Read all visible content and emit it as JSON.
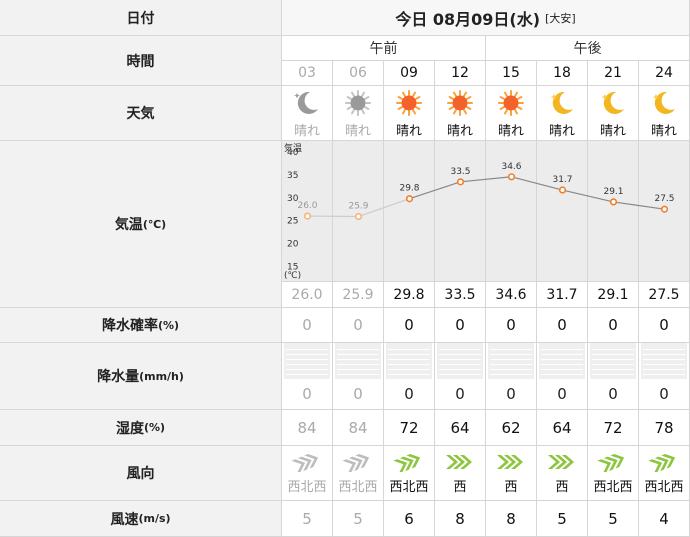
{
  "header": {
    "date_label": "日付",
    "title": "今日 08月09日(水)",
    "rokuyo": "[大安]"
  },
  "ampm": [
    "午前",
    "午後"
  ],
  "labels": {
    "time": "時間",
    "weather": "天気",
    "temp": "気温",
    "temp_unit": "(℃)",
    "precip_prob": "降水確率",
    "precip_prob_unit": "(%)",
    "precip_amount": "降水量",
    "precip_amount_unit": "(mm/h)",
    "humidity": "湿度",
    "humidity_unit": "(%)",
    "wind_dir": "風向",
    "wind_speed": "風速",
    "wind_speed_unit": "(m/s)"
  },
  "chart_axis": {
    "top_label": "気温",
    "bottom_label": "(℃)",
    "ticks": [
      "40",
      "35",
      "30",
      "25",
      "20",
      "15"
    ]
  },
  "hours": [
    {
      "time": "03",
      "icon": "moon-cloud-icon",
      "weather": "晴れ",
      "temp": 26.0,
      "temp_text": "26.0",
      "prob": "0",
      "amount": "0",
      "humidity": "84",
      "wind_dir": "西北西",
      "wind_speed": "5",
      "past": true
    },
    {
      "time": "06",
      "icon": "sun-cloud-icon",
      "weather": "晴れ",
      "temp": 25.9,
      "temp_text": "25.9",
      "prob": "0",
      "amount": "0",
      "humidity": "84",
      "wind_dir": "西北西",
      "wind_speed": "5",
      "past": true
    },
    {
      "time": "09",
      "icon": "sun-icon",
      "weather": "晴れ",
      "temp": 29.8,
      "temp_text": "29.8",
      "prob": "0",
      "amount": "0",
      "humidity": "72",
      "wind_dir": "西北西",
      "wind_speed": "6",
      "past": false
    },
    {
      "time": "12",
      "icon": "sun-icon",
      "weather": "晴れ",
      "temp": 33.5,
      "temp_text": "33.5",
      "prob": "0",
      "amount": "0",
      "humidity": "64",
      "wind_dir": "西",
      "wind_speed": "8",
      "past": false
    },
    {
      "time": "15",
      "icon": "sun-icon",
      "weather": "晴れ",
      "temp": 34.6,
      "temp_text": "34.6",
      "prob": "0",
      "amount": "0",
      "humidity": "62",
      "wind_dir": "西",
      "wind_speed": "8",
      "past": false
    },
    {
      "time": "18",
      "icon": "moon-icon",
      "weather": "晴れ",
      "temp": 31.7,
      "temp_text": "31.7",
      "prob": "0",
      "amount": "0",
      "humidity": "64",
      "wind_dir": "西",
      "wind_speed": "5",
      "past": false
    },
    {
      "time": "21",
      "icon": "moon-icon",
      "weather": "晴れ",
      "temp": 29.1,
      "temp_text": "29.1",
      "prob": "0",
      "amount": "0",
      "humidity": "72",
      "wind_dir": "西北西",
      "wind_speed": "5",
      "past": false
    },
    {
      "time": "24",
      "icon": "moon-icon",
      "weather": "晴れ",
      "temp": 27.5,
      "temp_text": "27.5",
      "prob": "0",
      "amount": "0",
      "humidity": "78",
      "wind_dir": "西北西",
      "wind_speed": "4",
      "past": false
    }
  ],
  "colors": {
    "sun": "#f2622a",
    "sun_glow": "#f9a13a",
    "moon": "#f3b520",
    "past_icon": "#9a9a9a",
    "wind_arrow": "#8cc63e",
    "line_current": "#888888",
    "line_past": "#cccccc",
    "marker": "#f07f2a"
  },
  "chart_data": {
    "type": "line",
    "x": [
      "03",
      "06",
      "09",
      "12",
      "15",
      "18",
      "21",
      "24"
    ],
    "series": [
      {
        "values": [
          26.0,
          25.9,
          29.8,
          33.5,
          34.6,
          31.7,
          29.1,
          27.5
        ]
      }
    ],
    "ylabel": "気温 (℃)",
    "yticks": [
      15,
      20,
      25,
      30,
      35,
      40
    ],
    "ylim": [
      12,
      42
    ]
  }
}
